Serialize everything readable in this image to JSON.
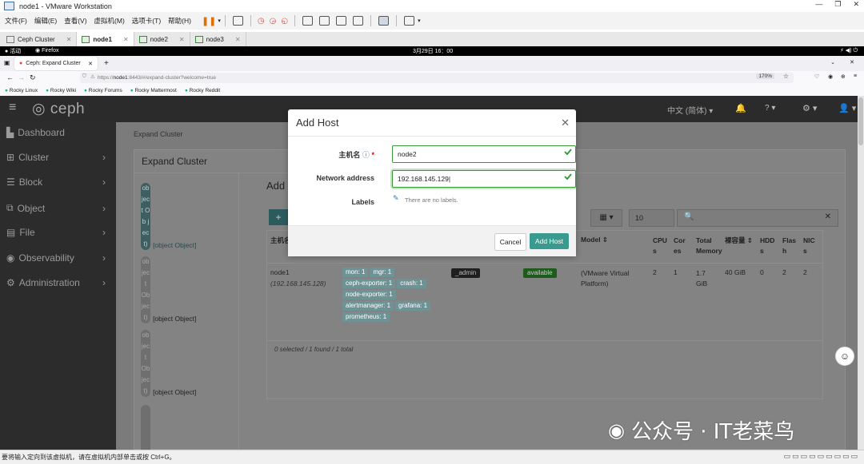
{
  "vmware": {
    "title": "node1 - VMware Workstation",
    "menu": [
      "文件(F)",
      "编辑(E)",
      "查看(V)",
      "虚拟机(M)",
      "选项卡(T)",
      "帮助(H)"
    ],
    "tabs": [
      {
        "label": "Ceph Cluster"
      },
      {
        "label": "node1"
      },
      {
        "label": "node2"
      },
      {
        "label": "node3"
      }
    ],
    "status_text": "要将输入定向到该虚拟机，请在虚拟机内部单击或按 Ctrl+G。"
  },
  "gnome": {
    "activities": "活动",
    "app": "Firefox",
    "clock": "3月29日 16：00"
  },
  "firefox": {
    "tab_title": "Ceph: Expand Cluster",
    "url_prefix": "https://",
    "url_host": "node1",
    "url_rest": ":8443/#/expand-cluster?welcome=true",
    "zoom": "170%",
    "bookmarks": [
      "Rocky Linux",
      "Rocky Wiki",
      "Rocky Forums",
      "Rocky Mattermost",
      "Rocky Reddit"
    ]
  },
  "ceph": {
    "brand": "ceph",
    "language": "中文 (简体)",
    "sidebar": [
      {
        "label": "Dashboard",
        "icon": "dashboard-icon"
      },
      {
        "label": "Cluster",
        "icon": "cluster-icon"
      },
      {
        "label": "Block",
        "icon": "block-icon"
      },
      {
        "label": "Object",
        "icon": "object-icon"
      },
      {
        "label": "File",
        "icon": "file-icon"
      },
      {
        "label": "Observability",
        "icon": "eye-icon"
      },
      {
        "label": "Administration",
        "icon": "cogs-icon"
      }
    ],
    "breadcrumb": "Expand Cluster",
    "page_title": "Expand Cluster",
    "steps": [
      {
        "label": "[object Object]"
      },
      {
        "label": "[object Object]"
      },
      {
        "label": "[object Object]"
      }
    ],
    "step_vertical": "[ob jec t Ob jec t]",
    "section_title": "Add",
    "page_size": "10",
    "table": {
      "headers": [
        "主机名",
        "Model",
        "CPUs",
        "Cores",
        "Total Memory",
        "裸容量",
        "HDDs",
        "Flash",
        "NICs"
      ],
      "row": {
        "hostname": "node1",
        "ip": "(192.168.145.128)",
        "services": [
          "mon: 1",
          "mgr: 1",
          "ceph-exporter: 1",
          "crash: 1",
          "node-exporter: 1",
          "alertmanager: 1",
          "grafana: 1",
          "prometheus: 1"
        ],
        "label": "_admin",
        "status": "available",
        "model": "(VMware Virtual Platform)",
        "cpus": "2",
        "cores": "1",
        "memory": "1.7 GiB",
        "raw": "40 GiB",
        "hdds": "0",
        "flash": "2",
        "nics": "2"
      },
      "footer": "0 selected / 1 found / 1 total"
    }
  },
  "modal": {
    "title": "Add Host",
    "hostname_label": "主机名",
    "hostname_value": "node2",
    "network_label": "Network address",
    "network_value": "192.168.145.129",
    "labels_label": "Labels",
    "labels_empty": "There are no labels.",
    "cancel": "Cancel",
    "submit": "Add Host"
  },
  "watermark": "公众号 · IT老菜鸟",
  "colors": {
    "accent": "#3a9a8f",
    "pill": "#6e9396",
    "available": "#2a8c2a",
    "valid": "#3a9a3a"
  }
}
